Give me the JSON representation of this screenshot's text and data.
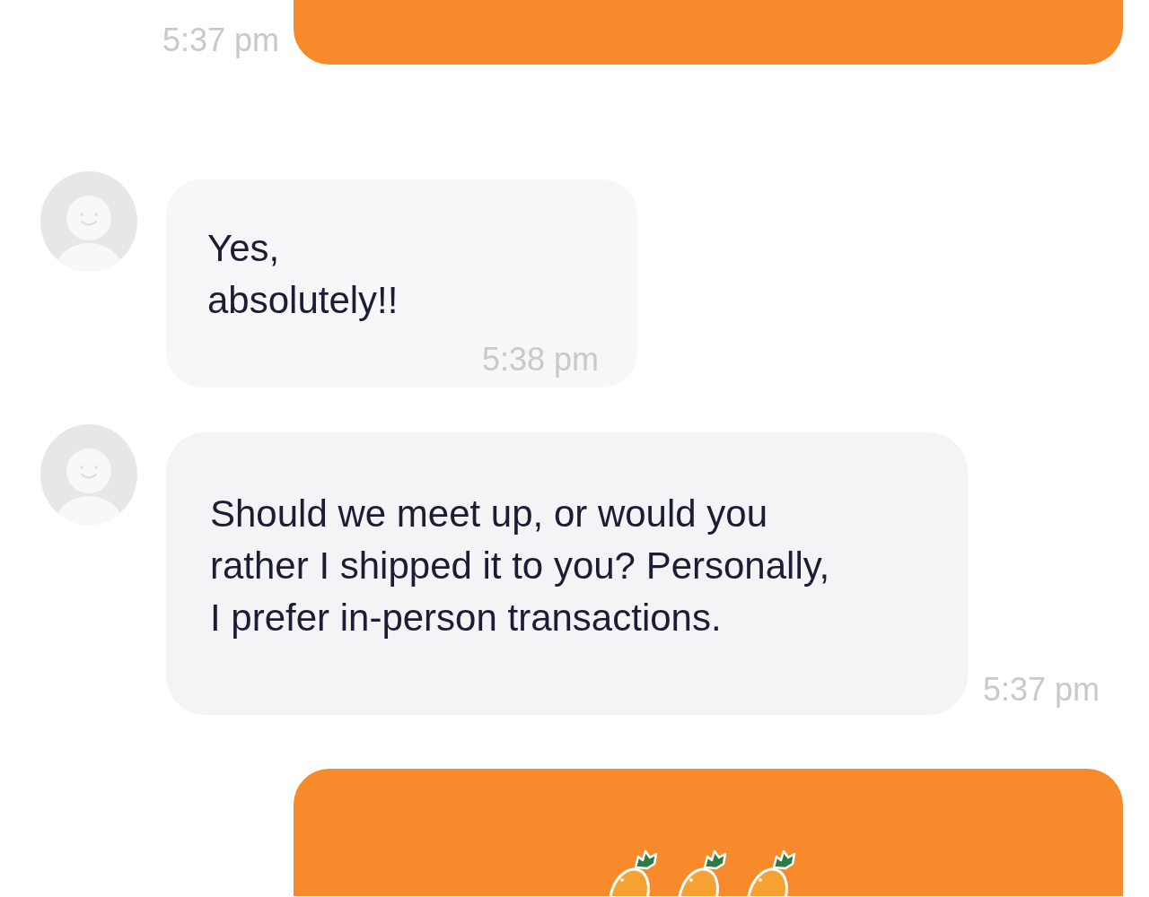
{
  "messages": [
    {
      "kind": "outgoing",
      "time": "5:37 pm"
    },
    {
      "kind": "incoming",
      "text": "Yes,\nabsolutely!!",
      "time": "5:38 pm"
    },
    {
      "kind": "incoming",
      "text": "Should we meet up, or would you\nrather I shipped it to you? Personally,\nI prefer in-person transactions.",
      "time": "5:37 pm"
    },
    {
      "kind": "sticker"
    }
  ]
}
